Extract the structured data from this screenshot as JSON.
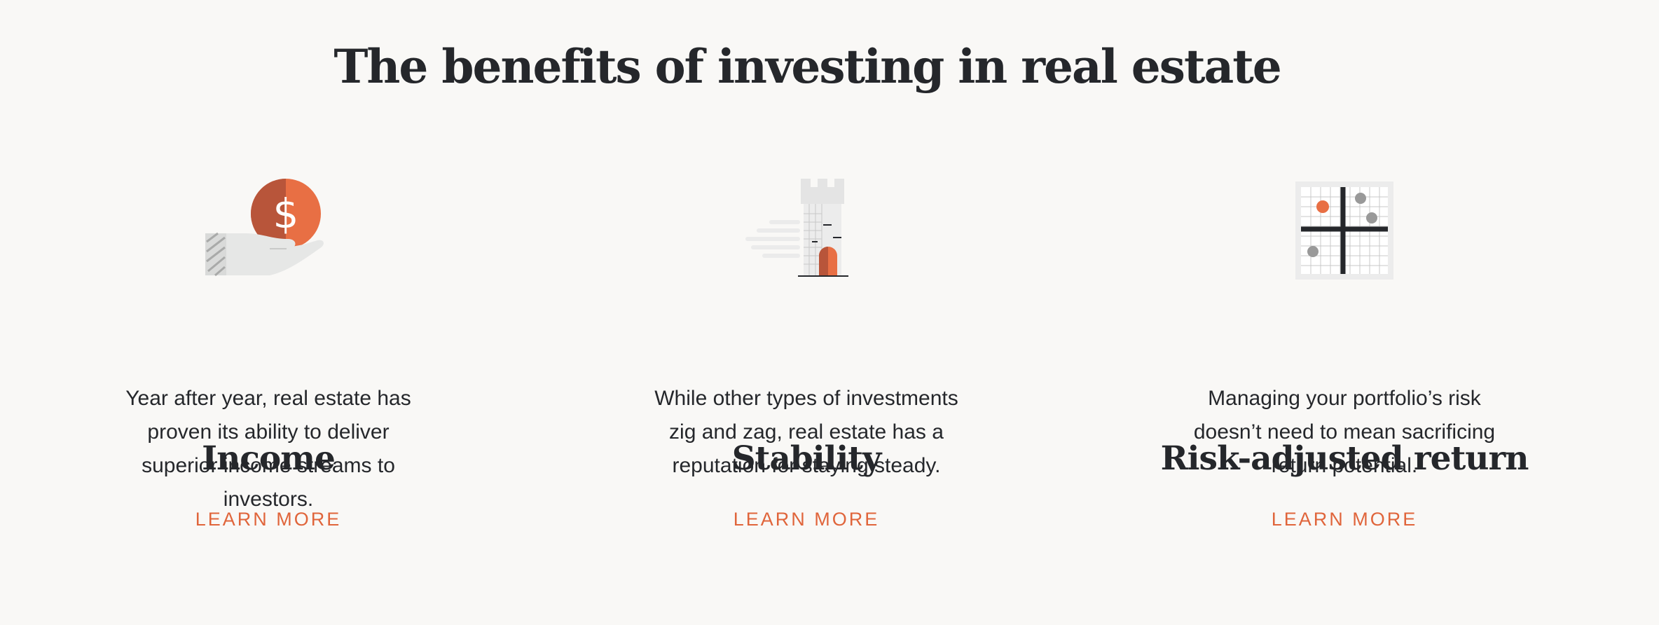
{
  "page": {
    "title": "The benefits of investing in real estate"
  },
  "benefits": [
    {
      "icon": "hand-holding-dollar-icon",
      "title": "Income",
      "description": "Year after year, real estate has proven its ability to deliver superior income streams to investors.",
      "link_label": "LEARN MORE"
    },
    {
      "icon": "tower-icon",
      "title": "Stability",
      "description": "While other types of investments zig and zag, real estate has a reputation for staying steady.",
      "link_label": "LEARN MORE"
    },
    {
      "icon": "scatter-grid-icon",
      "title": "Risk-adjusted return",
      "description": "Managing your portfolio’s risk doesn’t need to mean sacrificing return potential.",
      "link_label": "LEARN MORE"
    }
  ],
  "colors": {
    "background": "#f9f8f6",
    "text": "#25272b",
    "accent": "#e0653b",
    "accent_dark": "#b8553a",
    "icon_gray": "#e8e8e8"
  }
}
